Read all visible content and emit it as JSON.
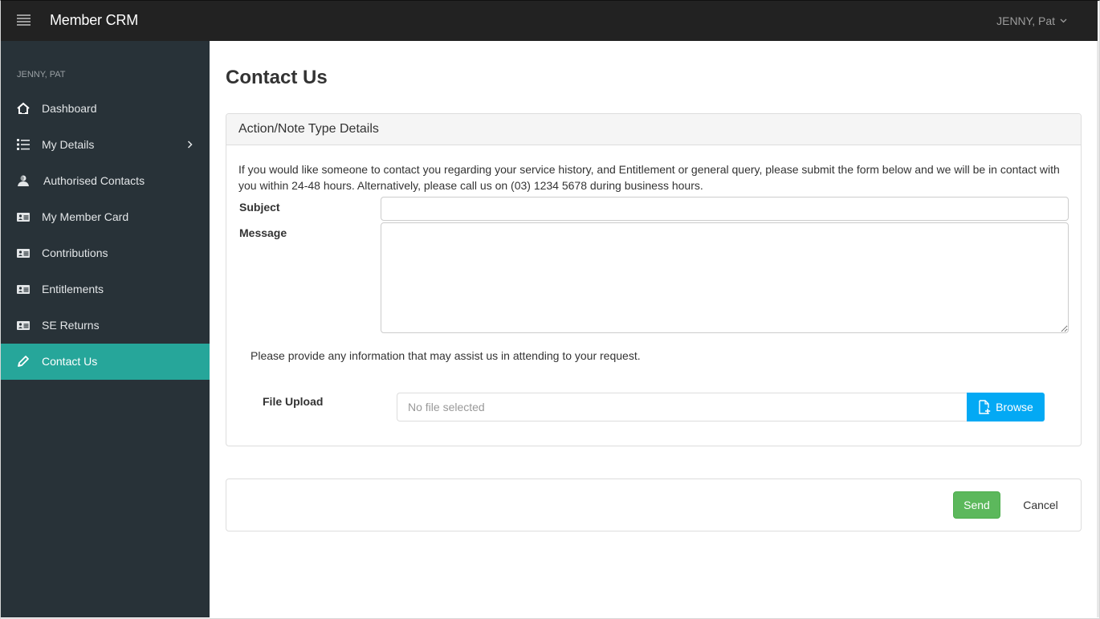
{
  "app": {
    "title": "Member CRM",
    "user_menu_label": "JENNY, Pat"
  },
  "sidebar": {
    "user_label": "JENNY, PAT",
    "items": [
      {
        "label": "Dashboard",
        "icon": "home-icon",
        "active": false
      },
      {
        "label": "My Details",
        "icon": "list-icon",
        "active": false,
        "has_submenu": true
      },
      {
        "label": "Authorised Contacts",
        "icon": "user-icon",
        "active": false
      },
      {
        "label": "My Member Card",
        "icon": "id-card-icon",
        "active": false
      },
      {
        "label": "Contributions",
        "icon": "id-card-icon",
        "active": false
      },
      {
        "label": "Entitlements",
        "icon": "id-card-icon",
        "active": false
      },
      {
        "label": "SE Returns",
        "icon": "id-card-icon",
        "active": false
      },
      {
        "label": "Contact Us",
        "icon": "pencil-icon",
        "active": true
      }
    ]
  },
  "main": {
    "page_title": "Contact Us",
    "panel": {
      "heading": "Action/Note Type Details",
      "intro": "If you would like someone to contact you regarding your service history, and Entitlement or general query, please submit the form below and we will be in contact with you within 24-48 hours. Alternatively, please call us on (03) 1234 5678 during business hours.",
      "subject_label": "Subject",
      "subject_value": "",
      "message_label": "Message",
      "message_value": "",
      "assist_text": "Please provide any information that may assist us in attending to your request.",
      "file_upload_label": "File Upload",
      "file_placeholder": "No file selected",
      "browse_label": "Browse"
    },
    "actions": {
      "send_label": "Send",
      "cancel_label": "Cancel"
    }
  },
  "colors": {
    "topbar": "#222222",
    "sidebar": "#283238",
    "active_item": "#26a69a",
    "browse_button": "#03a9f4",
    "send_button": "#5cb85c"
  }
}
